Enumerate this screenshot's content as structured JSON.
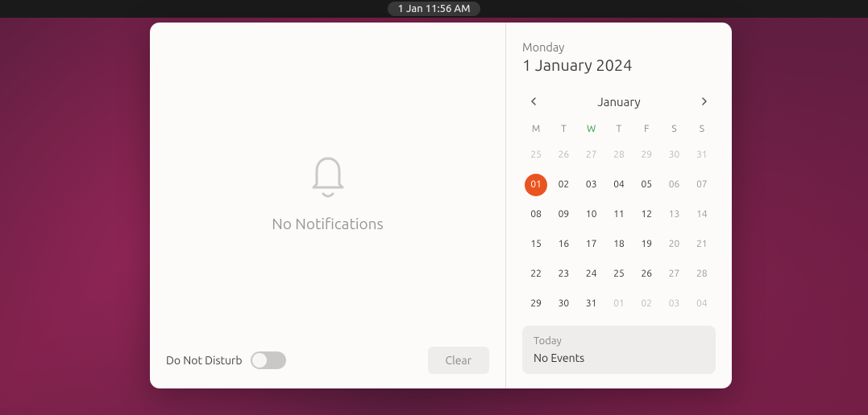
{
  "topbar": {
    "clock": "1 Jan  11:56 AM"
  },
  "notifications": {
    "empty_message": "No Notifications",
    "dnd_label": "Do Not Disturb",
    "clear_label": "Clear"
  },
  "calendar": {
    "weekday": "Monday",
    "full_date": "1 January 2024",
    "month_label": "January",
    "day_heads": [
      "M",
      "T",
      "W",
      "T",
      "F",
      "S",
      "S"
    ],
    "today_col_index": 2,
    "weeks": [
      [
        {
          "d": "25",
          "other": true
        },
        {
          "d": "26",
          "other": true
        },
        {
          "d": "27",
          "other": true
        },
        {
          "d": "28",
          "other": true
        },
        {
          "d": "29",
          "other": true
        },
        {
          "d": "30",
          "other": true
        },
        {
          "d": "31",
          "other": true
        }
      ],
      [
        {
          "d": "01",
          "today": true
        },
        {
          "d": "02"
        },
        {
          "d": "03"
        },
        {
          "d": "04"
        },
        {
          "d": "05"
        },
        {
          "d": "06",
          "weekend": true
        },
        {
          "d": "07",
          "weekend": true
        }
      ],
      [
        {
          "d": "08"
        },
        {
          "d": "09"
        },
        {
          "d": "10"
        },
        {
          "d": "11"
        },
        {
          "d": "12"
        },
        {
          "d": "13",
          "weekend": true
        },
        {
          "d": "14",
          "weekend": true
        }
      ],
      [
        {
          "d": "15"
        },
        {
          "d": "16"
        },
        {
          "d": "17"
        },
        {
          "d": "18"
        },
        {
          "d": "19"
        },
        {
          "d": "20",
          "weekend": true
        },
        {
          "d": "21",
          "weekend": true
        }
      ],
      [
        {
          "d": "22"
        },
        {
          "d": "23"
        },
        {
          "d": "24"
        },
        {
          "d": "25"
        },
        {
          "d": "26"
        },
        {
          "d": "27",
          "weekend": true
        },
        {
          "d": "28",
          "weekend": true
        }
      ],
      [
        {
          "d": "29"
        },
        {
          "d": "30"
        },
        {
          "d": "31"
        },
        {
          "d": "01",
          "other": true
        },
        {
          "d": "02",
          "other": true
        },
        {
          "d": "03",
          "other": true
        },
        {
          "d": "04",
          "other": true
        }
      ]
    ],
    "events": {
      "today_label": "Today",
      "no_events": "No Events"
    }
  }
}
